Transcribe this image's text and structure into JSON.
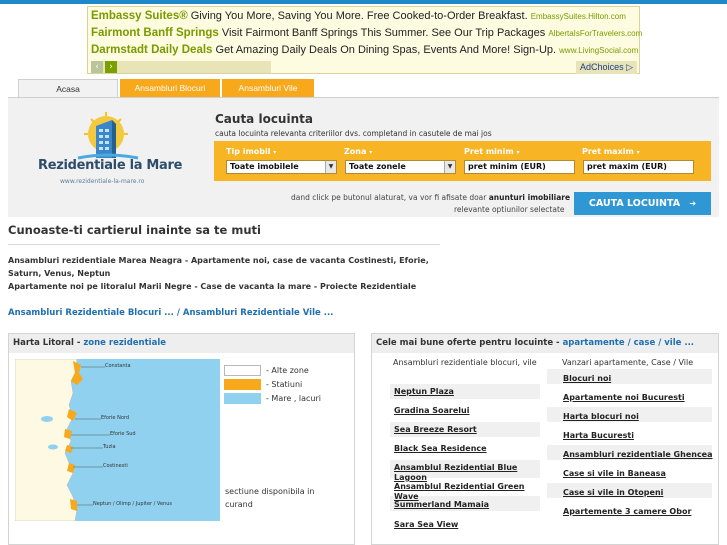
{
  "ads": [
    {
      "title": "Embassy Suites®",
      "desc": "Giving You More, Saving You More. Free Cooked-to-Order Breakfast.",
      "url": "EmbassySuites.Hilton.com"
    },
    {
      "title": "Fairmont Banff Springs",
      "desc": "Visit Fairmont Banff Springs This Summer. See Our Trip Packages",
      "url": "AlbertaIsForTravelers.com"
    },
    {
      "title": "Darmstadt Daily Deals",
      "desc": "Get Amazing Daily Deals On Dining Spas, Events And More! Sign-Up.",
      "url": "www.LivingSocial.com"
    }
  ],
  "ad_controls": {
    "prev": "‹",
    "next": "›",
    "adchoices": "AdChoices ▷"
  },
  "tabs": [
    "Acasa",
    "Ansambluri Blocuri",
    "Ansambluri Vile"
  ],
  "logo": {
    "name": "Rezidentiale la Mare",
    "url": "www.rezidentiale-la-mare.ro"
  },
  "search": {
    "title": "Cauta locuinta",
    "subtitle": "cauta locuinta relevanta criteriilor dvs. completand in casutele de mai jos",
    "fields": [
      {
        "label": "Tip imobil",
        "value": "Toate imobilele"
      },
      {
        "label": "Zona",
        "value": "Toate zonele"
      },
      {
        "label": "Pret minim",
        "value": "pret minim (EUR)"
      },
      {
        "label": "Pret maxim",
        "value": "pret maxim (EUR)"
      }
    ],
    "hint_a": "dand click pe butonul alaturat, va vor fi afisate doar ",
    "hint_b": "anunturi imobiliare",
    "hint_c": "relevante optiunilor selectate",
    "button": "CAUTA LOCUINTA",
    "button_icon": "➔"
  },
  "info": {
    "title": "Cunoaste-ti cartierul inainte sa te muti",
    "lines": [
      "Ansambluri rezidentiale Marea Neagra - Apartamente noi, case de vacanta Costinesti, Eforie,",
      "Saturn, Venus, Neptun",
      "Apartamente noi pe litoralul Marii Negre - Case de vacanta la mare - Proiecte Rezidentiale"
    ],
    "links": "Ansambluri Rezidentiale Blocuri ... / Ansambluri Rezidentiale Vile ..."
  },
  "harta": {
    "title": "Harta Litoral - ",
    "link": "zone rezidentiale",
    "places": [
      "Constanta",
      "Eforie Nord",
      "Eforie Sud",
      "Tuzla",
      "Costinesti",
      "Neptun / Olimp / Jupiter / Venus"
    ],
    "legend": [
      {
        "label": "- Alte zone",
        "color": "#fdf9e3"
      },
      {
        "label": "- Statiuni",
        "color": "#f7a81b"
      },
      {
        "label": "- Mare , lacuri",
        "color": "#8fd1ef"
      }
    ],
    "note_1": "sectiune disponibila in",
    "note_2": "curand"
  },
  "oferte": {
    "title": "Cele mai bune oferte pentru locuinte - ",
    "link": "apartamente / case / vile ...",
    "col1_head": "Ansambluri rezidentiale blocuri, vile",
    "col2_head": "Vanzari apartamente, Case / Vile",
    "col1": [
      "Neptun Plaza",
      "Gradina Soarelui",
      "Sea Breeze Resort",
      "Black Sea Residence",
      "Ansamblul Rezidential Blue Lagoon",
      "Ansamblul Rezidential Green Wave",
      "Summerland Mamaia",
      "Sara Sea View"
    ],
    "col2": [
      "Blocuri noi",
      "Apartamente noi Bucuresti",
      "Harta blocuri noi",
      "Harta Bucuresti",
      "Ansambluri rezidentiale Ghencea",
      "Case si vile in Baneasa",
      "Case si vile in Otopeni",
      "Apartemente 3 camere Obor"
    ]
  },
  "colors": {
    "accent_orange": "#f7b526",
    "accent_blue": "#2f97d3",
    "link_blue": "#1f6fb0",
    "ad_green": "#7a9a00"
  }
}
